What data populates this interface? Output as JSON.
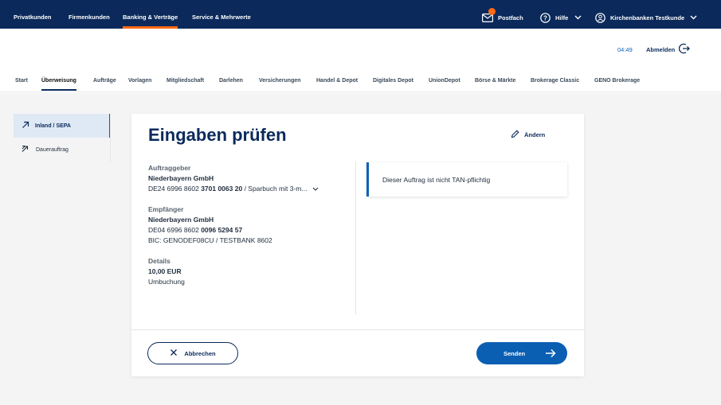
{
  "topnav": {
    "tabs": [
      {
        "label": "Privatkunden"
      },
      {
        "label": "Firmenkunden"
      },
      {
        "label": "Banking & Verträge"
      },
      {
        "label": "Service & Mehrwerte"
      }
    ],
    "postfach": "Postfach",
    "hilfe": "Hilfe",
    "user": "Kirchenbanken Testkunde",
    "accent_color": "#ff6a13"
  },
  "header": {
    "timer": "04:49",
    "logout": "Abmelden"
  },
  "subnav": {
    "items": [
      {
        "label": "Start"
      },
      {
        "label": "Überweisung"
      },
      {
        "label": "Aufträge"
      },
      {
        "label": "Vorlagen"
      },
      {
        "label": "Mitgliedschaft"
      },
      {
        "label": "Darlehen"
      },
      {
        "label": "Versicherungen"
      },
      {
        "label": "Handel & Depot"
      },
      {
        "label": "Digitales Depot"
      },
      {
        "label": "UnionDepot"
      },
      {
        "label": "Börse & Märkte"
      },
      {
        "label": "Brokerage Classic"
      },
      {
        "label": "GENO Brokerage"
      }
    ]
  },
  "sidenav": {
    "items": [
      {
        "label": "Inland / SEPA"
      },
      {
        "label": "Dauerauftrag"
      }
    ]
  },
  "card": {
    "title": "Eingaben prüfen",
    "edit": "Ändern",
    "auftraggeber": {
      "label": "Auftraggeber",
      "name": "Niederbayern GmbH",
      "iban_prefix": "DE24 6996 8602",
      "iban_bold": "3701 0063 20",
      "account_suffix": "/ Sparbuch mit 3-m..."
    },
    "empfaenger": {
      "label": "Empfänger",
      "name": "Niederbayern GmbH",
      "iban_prefix": "DE04 6996 8602",
      "iban_bold": "0096 5294 57",
      "bic": "BIC: GENODEF08CU / TESTBANK 8602"
    },
    "details": {
      "label": "Details",
      "amount": "10,00 EUR",
      "purpose": "Umbuchung"
    },
    "notice": "Dieser Auftrag ist nicht TAN-pflichtig",
    "cancel": "Abbrechen",
    "send": "Senden"
  }
}
